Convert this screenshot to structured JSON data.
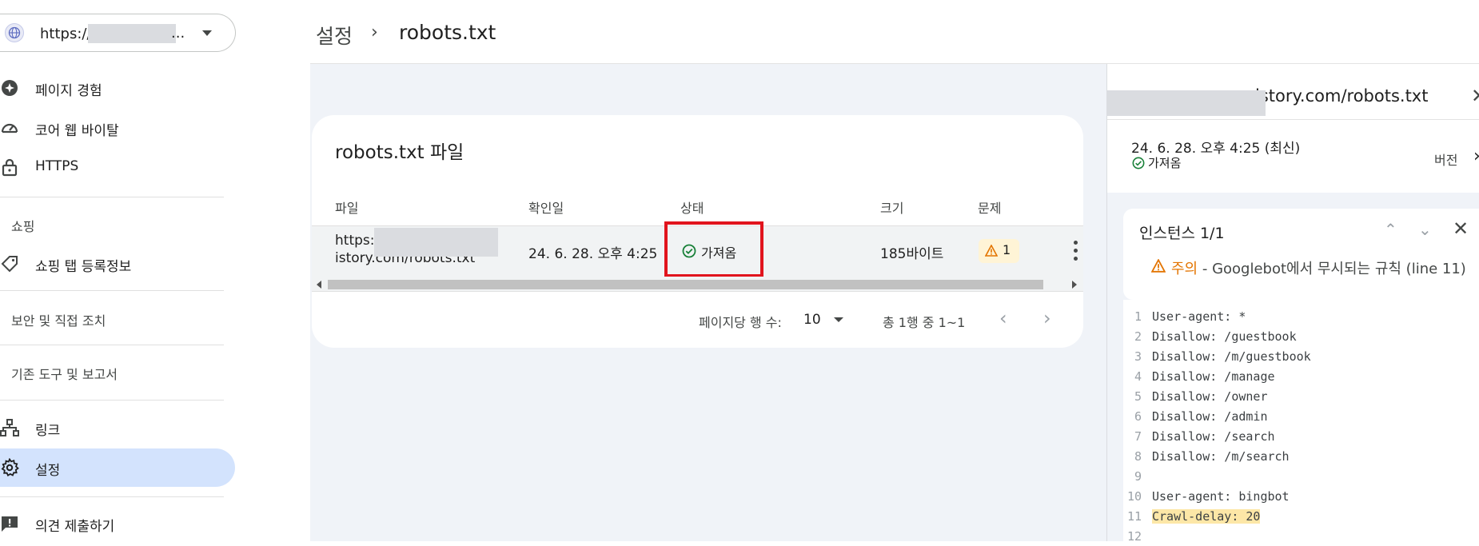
{
  "sidebar": {
    "property": {
      "url_prefix": "https://",
      "ellipsis": "..."
    },
    "items": [
      {
        "label": "페이지 경험",
        "icon": "page-experience-icon"
      },
      {
        "label": "코어 웹 바이탈",
        "icon": "speed-gauge-icon"
      },
      {
        "label": "HTTPS",
        "icon": "lock-icon"
      },
      {
        "label": "쇼핑 탭 등록정보",
        "icon": "tag-icon"
      },
      {
        "label": "링크",
        "icon": "sitemap-icon"
      },
      {
        "label": "설정",
        "icon": "gear-icon"
      },
      {
        "label": "의견 제출하기",
        "icon": "feedback-icon"
      }
    ],
    "sections": [
      "쇼핑",
      "보안 및 직접 조치",
      "기존 도구 및 보고서"
    ]
  },
  "header": {
    "breadcrumb_1": "설정",
    "breadcrumb_sep": "›",
    "breadcrumb_2": "robots.txt"
  },
  "card": {
    "title": "robots.txt 파일",
    "columns": [
      "파일",
      "확인일",
      "상태",
      "크기",
      "문제"
    ],
    "row": {
      "file_line1": "https:/",
      "file_line2": "istory.com/robots.txt",
      "checked": "24. 6. 28. 오후 4:25",
      "status": "가져옴",
      "size": "185바이트",
      "issues": "1"
    },
    "pager": {
      "rows_label": "페이지당 행 수:",
      "rows_value": "10",
      "range": "총 1행 중 1~1"
    }
  },
  "panel": {
    "title": "istory.com/robots.txt",
    "version_date": "24. 6. 28. 오후 4:25 (최신)",
    "version_status": "가져옴",
    "version_label": "버전",
    "instance_title": "인스턴스 1/1",
    "warning_word": "주의",
    "warning_text": " - Googlebot에서 무시되는 규칙 (line 11)",
    "code": [
      {
        "n": "1",
        "t": "User-agent: *"
      },
      {
        "n": "2",
        "t": "Disallow: /guestbook"
      },
      {
        "n": "3",
        "t": "Disallow: /m/guestbook"
      },
      {
        "n": "4",
        "t": "Disallow: /manage"
      },
      {
        "n": "5",
        "t": "Disallow: /owner"
      },
      {
        "n": "6",
        "t": "Disallow: /admin"
      },
      {
        "n": "7",
        "t": "Disallow: /search"
      },
      {
        "n": "8",
        "t": "Disallow: /m/search"
      },
      {
        "n": "9",
        "t": ""
      },
      {
        "n": "10",
        "t": "User-agent: bingbot"
      },
      {
        "n": "11",
        "t": "Crawl-delay: 20"
      },
      {
        "n": "12",
        "t": ""
      }
    ]
  },
  "colors": {
    "accent_active": "#d3e3fd",
    "success": "#188038",
    "warning": "#e37400",
    "highlight_box": "#e1141d"
  }
}
